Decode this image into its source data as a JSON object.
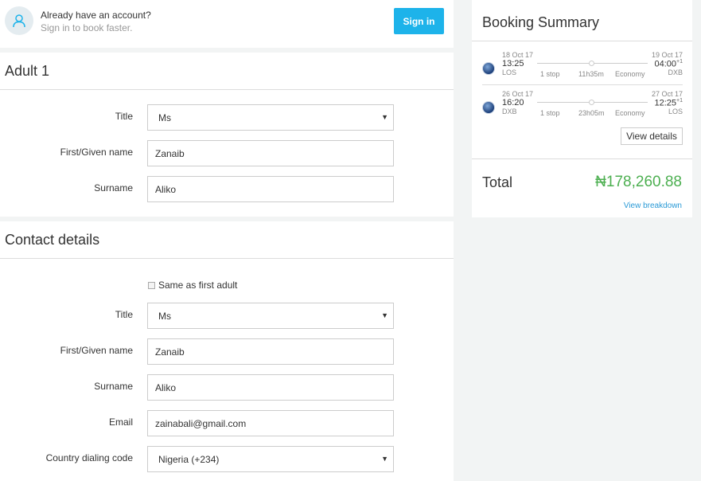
{
  "signin": {
    "line1": "Already have an account?",
    "line2": "Sign in to book faster.",
    "button": "Sign in"
  },
  "adult": {
    "heading": "Adult 1",
    "title_label": "Title",
    "title_value": "Ms",
    "first_label": "First/Given name",
    "first_value": "Zanaib",
    "surname_label": "Surname",
    "surname_value": "Aliko"
  },
  "contact": {
    "heading": "Contact details",
    "same_as": "Same as first adult",
    "title_label": "Title",
    "title_value": "Ms",
    "first_label": "First/Given name",
    "first_value": "Zanaib",
    "surname_label": "Surname",
    "surname_value": "Aliko",
    "email_label": "Email",
    "email_value": "zainabali@gmail.com",
    "country_label": "Country dialing code",
    "country_value": "Nigeria (+234)"
  },
  "summary": {
    "title": "Booking Summary",
    "legs": [
      {
        "dep_date": "18 Oct 17",
        "dep_time": "13:25",
        "dep_airport": "LOS",
        "arr_date": "19 Oct 17",
        "arr_time": "04:00",
        "arr_plus": "+1",
        "arr_airport": "DXB",
        "stops": "1 stop",
        "duration": "11h35m",
        "cabin": "Economy"
      },
      {
        "dep_date": "26 Oct 17",
        "dep_time": "16:20",
        "dep_airport": "DXB",
        "arr_date": "27 Oct 17",
        "arr_time": "12:25",
        "arr_plus": "+1",
        "arr_airport": "LOS",
        "stops": "1 stop",
        "duration": "23h05m",
        "cabin": "Economy"
      }
    ],
    "view_details": "View details",
    "total_label": "Total",
    "total_value": "₦178,260.88",
    "view_breakdown": "View breakdown"
  },
  "colors": {
    "accent": "#1db3ea",
    "total": "#4caf50",
    "link": "#2a9ad6"
  }
}
